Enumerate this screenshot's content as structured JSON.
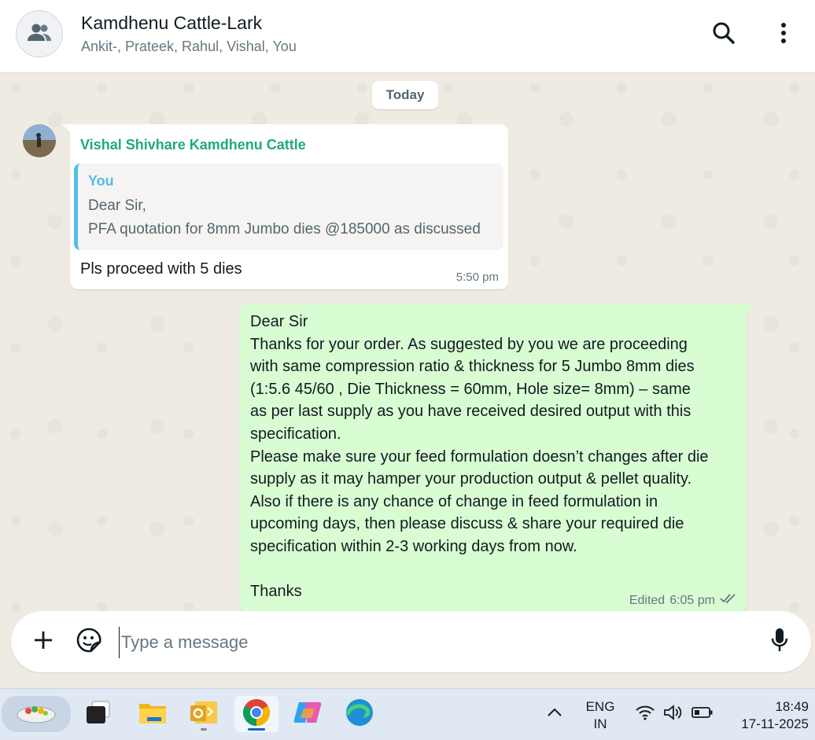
{
  "header": {
    "title": "Kamdhenu Cattle-Lark",
    "members": "Ankit-, Prateek, Rahul, Vishal, You",
    "avatar_icon": "group-icon",
    "search_icon": "search-icon",
    "menu_icon": "more-vertical-icon"
  },
  "chat": {
    "date_chip": "Today",
    "incoming": {
      "sender": "Vishal Shivhare Kamdhenu Cattle",
      "quote_author": "You",
      "quote_line1": "Dear Sir,",
      "quote_line2": "PFA quotation for 8mm Jumbo dies @185000 as discussed",
      "text": "Pls proceed with 5 dies",
      "time": "5:50 pm"
    },
    "outgoing": {
      "lines": [
        "Dear Sir",
        "Thanks for your order. As suggested by you we are proceeding",
        "with same compression ratio & thickness for 5 Jumbo 8mm dies",
        "(1:5.6   45/60 , Die Thickness =  60mm, Hole size= 8mm) – same",
        "as per last supply as you have received desired output with this",
        "specification.",
        "Please make sure your feed formulation doesn’t changes after die",
        "supply as it may hamper your production output & pellet quality.",
        "Also if there is any chance of change in feed formulation in",
        "upcoming days, then please discuss & share your required die",
        "specification within 2-3 working days from now.",
        "",
        "Thanks"
      ],
      "edited_label": "Edited",
      "time": "6:05 pm",
      "status_icon": "double-check-icon"
    }
  },
  "composer": {
    "placeholder": "Type a message",
    "value": "",
    "attach_icon": "plus-icon",
    "sticker_icon": "sticker-icon",
    "mic_icon": "microphone-icon"
  },
  "taskbar": {
    "apps": [
      "widgets-icon",
      "task-view-icon",
      "file-explorer-icon",
      "outlook-icon",
      "chrome-icon",
      "copilot-icon",
      "edge-icon"
    ],
    "tray": {
      "chevron_icon": "chevron-up-icon",
      "lang_line1": "ENG",
      "lang_line2": "IN",
      "wifi_icon": "wifi-icon",
      "volume_icon": "volume-icon",
      "battery_icon": "battery-icon",
      "time": "18:49",
      "date": "17-11-2025"
    }
  },
  "colors": {
    "sender_name": "#1fa884",
    "quote_accent": "#53bdeb",
    "outgoing_bubble": "#d9fdd3",
    "chat_bg": "#efeae2"
  }
}
